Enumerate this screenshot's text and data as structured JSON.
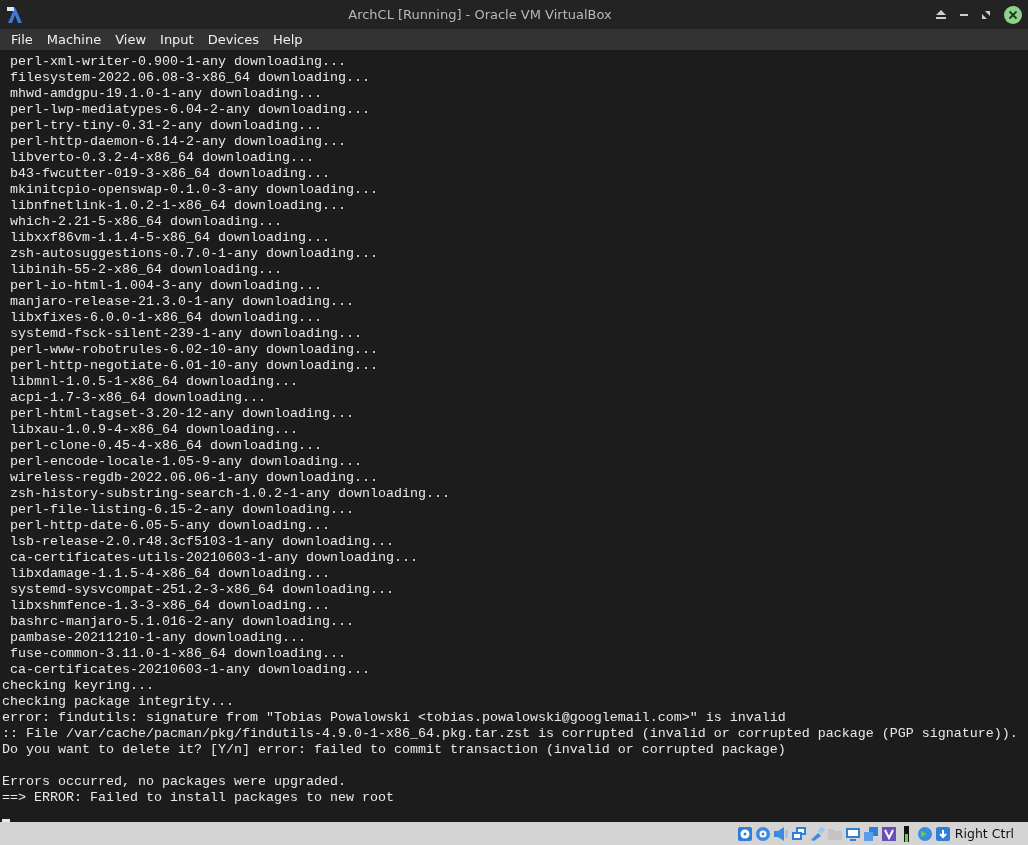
{
  "window": {
    "title": "ArchCL [Running] - Oracle VM VirtualBox"
  },
  "menu": [
    "File",
    "Machine",
    "View",
    "Input",
    "Devices",
    "Help"
  ],
  "terminal": {
    "blocks": [
      [
        " perl-xml-writer-0.900-1-any downloading...",
        " filesystem-2022.06.08-3-x86_64 downloading...",
        " mhwd-amdgpu-19.1.0-1-any downloading...",
        " perl-lwp-mediatypes-6.04-2-any downloading...",
        " perl-try-tiny-0.31-2-any downloading...",
        " perl-http-daemon-6.14-2-any downloading...",
        " libverto-0.3.2-4-x86_64 downloading...",
        " b43-fwcutter-019-3-x86_64 downloading...",
        " mkinitcpio-openswap-0.1.0-3-any downloading...",
        " libnfnetlink-1.0.2-1-x86_64 downloading...",
        " which-2.21-5-x86_64 downloading...",
        " libxxf86vm-1.1.4-5-x86_64 downloading...",
        " zsh-autosuggestions-0.7.0-1-any downloading...",
        " libinih-55-2-x86_64 downloading...",
        " perl-io-html-1.004-3-any downloading...",
        " manjaro-release-21.3.0-1-any downloading...",
        " libxfixes-6.0.0-1-x86_64 downloading...",
        " systemd-fsck-silent-239-1-any downloading...",
        " perl-www-robotrules-6.02-10-any downloading...",
        " perl-http-negotiate-6.01-10-any downloading...",
        " libmnl-1.0.5-1-x86_64 downloading...",
        " acpi-1.7-3-x86_64 downloading...",
        " perl-html-tagset-3.20-12-any downloading...",
        " libxau-1.0.9-4-x86_64 downloading...",
        " perl-clone-0.45-4-x86_64 downloading...",
        " perl-encode-locale-1.05-9-any downloading...",
        " wireless-regdb-2022.06.06-1-any downloading...",
        " zsh-history-substring-search-1.0.2-1-any downloading...",
        " perl-file-listing-6.15-2-any downloading...",
        " perl-http-date-6.05-5-any downloading...",
        " lsb-release-2.0.r48.3cf5103-1-any downloading...",
        " ca-certificates-utils-20210603-1-any downloading...",
        " libxdamage-1.1.5-4-x86_64 downloading...",
        " systemd-sysvcompat-251.2-3-x86_64 downloading...",
        " libxshmfence-1.3-3-x86_64 downloading...",
        " bashrc-manjaro-5.1.016-2-any downloading...",
        " pambase-20211210-1-any downloading...",
        " fuse-common-3.11.0-1-x86_64 downloading...",
        " ca-certificates-20210603-1-any downloading...",
        "checking keyring...",
        "checking package integrity...",
        "error: findutils: signature from \"Tobias Powalowski <tobias.powalowski@googlemail.com>\" is invalid",
        ":: File /var/cache/pacman/pkg/findutils-4.9.0-1-x86_64.pkg.tar.zst is corrupted (invalid or corrupted package (PGP signature)).",
        "Do you want to delete it? [Y/n] error: failed to commit transaction (invalid or corrupted package)"
      ],
      [
        "Errors occurred, no packages were upgraded.",
        "==> ERROR: Failed to install packages to new root"
      ]
    ]
  },
  "status_bar": {
    "indicators": [
      {
        "kind": "hard-disk",
        "disabled": false
      },
      {
        "kind": "optical-drive",
        "disabled": false
      },
      {
        "kind": "audio",
        "disabled": false
      },
      {
        "kind": "network",
        "disabled": false
      },
      {
        "kind": "usb",
        "disabled": false
      },
      {
        "kind": "shared-folders",
        "disabled": true
      },
      {
        "kind": "display",
        "disabled": false
      },
      {
        "kind": "recording",
        "disabled": false
      },
      {
        "kind": "cpu",
        "disabled": false
      },
      {
        "kind": "meter",
        "disabled": false
      },
      {
        "kind": "mouse",
        "disabled": false
      },
      {
        "kind": "keyboard",
        "disabled": false
      }
    ],
    "host_key": "Right Ctrl"
  }
}
